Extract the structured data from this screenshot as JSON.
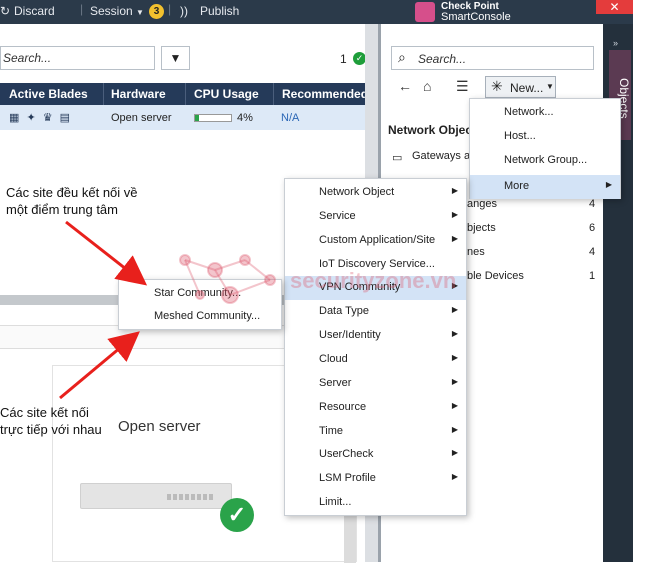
{
  "toolbar": {
    "discard": "Discard",
    "session": "Session",
    "session_badge": "3",
    "publish": "Publish",
    "logo_line1": "Check Point",
    "logo_line2": "SmartConsole",
    "close": "✕"
  },
  "left_pane": {
    "search_placeholder": "Search...",
    "count": "1",
    "columns": [
      "Active Blades",
      "Hardware",
      "CPU Usage",
      "Recommended"
    ],
    "row": {
      "blades": "▦ ✦ ♛ ▤",
      "hardware": "Open server",
      "cpu": "4%",
      "cpu_percent": 4,
      "recommended": "N/A"
    },
    "card_label": "Open server"
  },
  "right_panel": {
    "search_placeholder": "Search...",
    "new_button": "New...",
    "section_title": "Network Objec",
    "vertical_tab": "Objects",
    "list": [
      {
        "label": "Gateways a",
        "count": ""
      },
      {
        "label": "anges",
        "count": "4"
      },
      {
        "label": "bjects",
        "count": "6"
      },
      {
        "label": "nes",
        "count": "4"
      },
      {
        "label": "ble Devices",
        "count": "1"
      }
    ]
  },
  "new_menu": {
    "items": [
      {
        "label": "Network...",
        "has_sub": false
      },
      {
        "label": "Host...",
        "has_sub": false
      },
      {
        "label": "Network Group...",
        "has_sub": false
      },
      {
        "label": "More",
        "has_sub": true
      }
    ]
  },
  "more_menu": {
    "items": [
      {
        "label": "Network Object",
        "has_sub": true
      },
      {
        "label": "Service",
        "has_sub": true
      },
      {
        "label": "Custom Application/Site",
        "has_sub": true
      },
      {
        "label": "IoT Discovery Service...",
        "has_sub": false
      },
      {
        "label": "VPN Community",
        "has_sub": true
      },
      {
        "label": "Data Type",
        "has_sub": true
      },
      {
        "label": "User/Identity",
        "has_sub": true
      },
      {
        "label": "Cloud",
        "has_sub": true
      },
      {
        "label": "Server",
        "has_sub": true
      },
      {
        "label": "Resource",
        "has_sub": true
      },
      {
        "label": "Time",
        "has_sub": true
      },
      {
        "label": "UserCheck",
        "has_sub": true
      },
      {
        "label": "LSM Profile",
        "has_sub": true
      },
      {
        "label": "Limit...",
        "has_sub": false
      }
    ]
  },
  "vpn_menu": {
    "items": [
      "Star Community...",
      "Meshed Community..."
    ]
  },
  "annotations": {
    "top_line1": "Các site đều kết nối về",
    "top_line2": "một điểm trung tâm",
    "bottom_line1": "Các site kết nối",
    "bottom_line2": "trực tiếp với nhau"
  },
  "watermark": "securityzone.vn",
  "colors": {
    "header_bg": "#253a59",
    "selected_row": "#dde9f7",
    "menu_highlight": "#d3e3f6",
    "ok_green": "#2aa34a",
    "arrow_red": "#e8201c"
  }
}
